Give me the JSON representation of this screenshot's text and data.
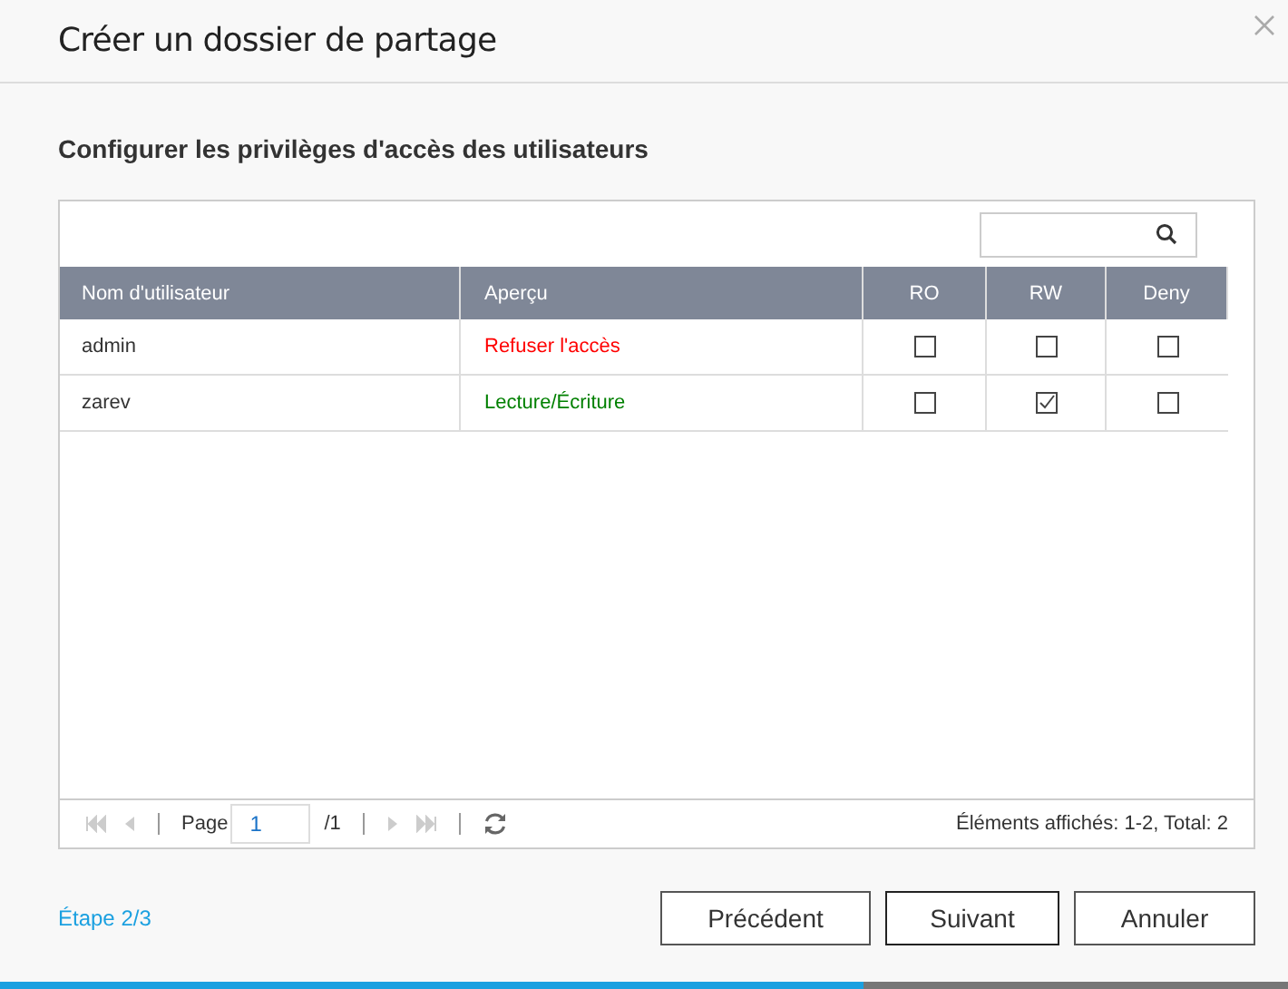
{
  "window": {
    "title": "Créer un dossier de partage"
  },
  "subtitle": "Configurer les privilèges d'accès des utilisateurs",
  "table": {
    "columns": [
      "Nom d'utilisateur",
      "Aperçu",
      "RO",
      "RW",
      "Deny"
    ],
    "rows": [
      {
        "name": "admin",
        "preview": "Refuser l'accès",
        "color": "#ff0000",
        "checks": [
          {
            "checked": false
          },
          {
            "checked": false
          },
          {
            "checked": false
          }
        ]
      },
      {
        "name": "zarev",
        "preview": "Lecture/Écriture",
        "color": "#008000",
        "checks": [
          {
            "checked": false
          },
          {
            "checked": true
          },
          {
            "checked": false
          }
        ]
      }
    ]
  },
  "pager": {
    "label": "Page",
    "page": "1",
    "total": "/1",
    "summary": "Éléments affichés: 1-2, Total: 2"
  },
  "step": "Étape 2/3",
  "buttons": [
    "Précédent",
    "Suivant",
    "Annuler"
  ],
  "progress": {
    "level": 0.67
  }
}
